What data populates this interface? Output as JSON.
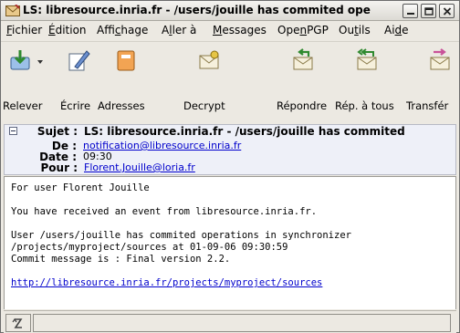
{
  "window": {
    "title": "LS: libresource.inria.fr - /users/jouille has commited ope"
  },
  "menu": [
    {
      "label": "Fichier",
      "mnemonic": "F",
      "rest": "ichier"
    },
    {
      "label": "Édition",
      "mnemonic": "É",
      "rest": "dition"
    },
    {
      "label": "Affichage",
      "pre": "Affi",
      "mnemonic": "c",
      "rest": "hage"
    },
    {
      "label": "Aller à",
      "pre": "A",
      "mnemonic": "l",
      "rest": "ler à"
    },
    {
      "label": "Messages",
      "mnemonic": "M",
      "rest": "essages"
    },
    {
      "label": "OpenPGP",
      "pre": "Ope",
      "mnemonic": "n",
      "rest": "PGP"
    },
    {
      "label": "Outils",
      "pre": "Ou",
      "mnemonic": "t",
      "rest": "ils"
    },
    {
      "label": "Aide",
      "pre": "Ai",
      "mnemonic": "d",
      "rest": "e"
    }
  ],
  "toolbar": {
    "relever": "Relever",
    "ecrire": "Écrire",
    "adresses": "Adresses",
    "decrypt": "Decrypt",
    "repondre": "Répondre",
    "rep_tous": "Rép. à tous",
    "transferer": "Transfér"
  },
  "header": {
    "subject_label": "Sujet :",
    "subject": "LS: libresource.inria.fr - /users/jouille has commited",
    "from_label": "De :",
    "from": "notification@libresource.inria.fr",
    "date_label": "Date :",
    "date": "09:30",
    "to_label": "Pour :",
    "to": "Florent.Jouille@loria.fr"
  },
  "message": {
    "line1": "For user Florent Jouille",
    "line2": "You have received an event from libresource.inria.fr.",
    "line3": "User /users/jouille has commited operations in synchronizer",
    "line4": "/projects/myproject/sources at 01-09-06 09:30:59",
    "line5": "Commit message is : Final version 2.2.",
    "link": "http://libresource.inria.fr/projects/myproject/sources"
  },
  "colors": {
    "link": "#0000cc",
    "header_bg": "#eef0f8",
    "chrome_bg": "#ece9e2"
  }
}
